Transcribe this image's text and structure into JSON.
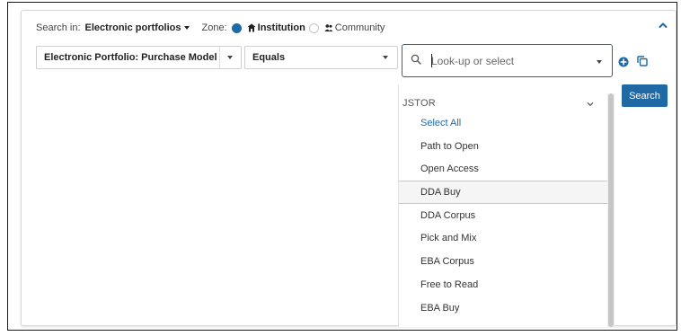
{
  "search_bar": {
    "search_in_label": "Search in:",
    "search_in_value": "Electronic portfolios",
    "zone_label": "Zone:",
    "zone_options": [
      {
        "label": "Institution",
        "selected": true
      },
      {
        "label": "Community",
        "selected": false
      }
    ]
  },
  "criteria": {
    "field": "Electronic Portfolio: Purchase Model",
    "operator": "Equals",
    "value_placeholder": "Look-up or select"
  },
  "actions": {
    "search_label": "Search"
  },
  "dropdown": {
    "group_label": "JSTOR",
    "items": [
      {
        "label": "Select All"
      },
      {
        "label": "Path to Open"
      },
      {
        "label": "Open Access"
      },
      {
        "label": "DDA Buy"
      },
      {
        "label": "DDA Corpus"
      },
      {
        "label": "Pick and Mix"
      },
      {
        "label": "EBA Corpus"
      },
      {
        "label": "Free to Read"
      },
      {
        "label": "EBA Buy"
      }
    ],
    "hovered_item": "DDA Buy"
  },
  "colors": {
    "accent": "#1f6aa5",
    "select_all": "#1f6aa5",
    "hover_bg": "#f5f5f5"
  },
  "icons": [
    "chevron-up-icon",
    "chevron-down-icon",
    "search-icon",
    "add-circle-icon",
    "copy-icon",
    "institution-icon",
    "community-icon"
  ]
}
